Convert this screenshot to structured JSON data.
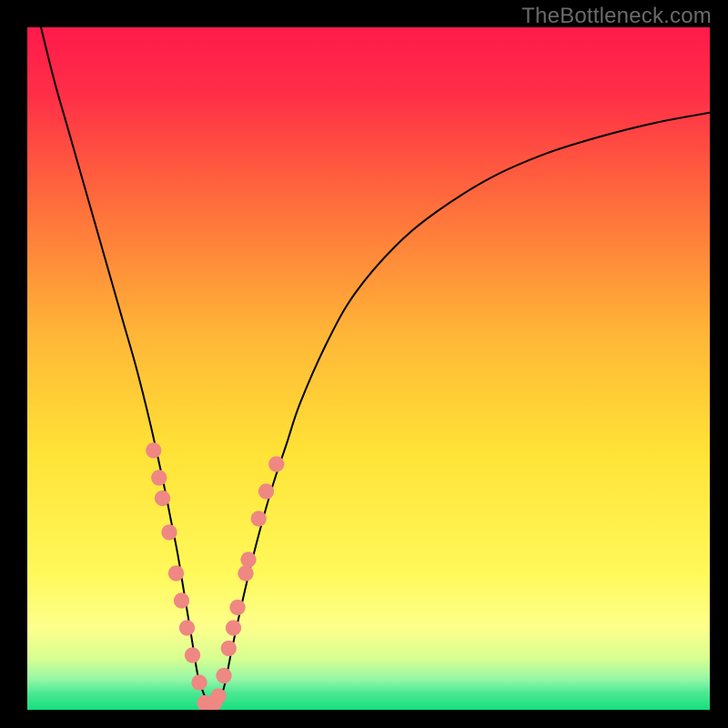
{
  "watermark": "TheBottleneck.com",
  "colors": {
    "frame": "#000000",
    "curve": "#000000",
    "marker_fill": "#ef8783",
    "gradient_stops": [
      {
        "offset": 0.0,
        "color": "#ff1a4b"
      },
      {
        "offset": 0.1,
        "color": "#ff2f47"
      },
      {
        "offset": 0.25,
        "color": "#ff6a3c"
      },
      {
        "offset": 0.45,
        "color": "#ffb637"
      },
      {
        "offset": 0.62,
        "color": "#ffe236"
      },
      {
        "offset": 0.8,
        "color": "#fff95a"
      },
      {
        "offset": 0.88,
        "color": "#fdff8c"
      },
      {
        "offset": 0.925,
        "color": "#d7ff91"
      },
      {
        "offset": 0.955,
        "color": "#96f7a6"
      },
      {
        "offset": 0.975,
        "color": "#4de893"
      },
      {
        "offset": 1.0,
        "color": "#13e07f"
      }
    ]
  },
  "chart_data": {
    "type": "line",
    "title": "",
    "xlabel": "",
    "ylabel": "",
    "xlim": [
      0,
      100
    ],
    "ylim": [
      0,
      100
    ],
    "series": [
      {
        "name": "bottleneck-curve",
        "x": [
          2,
          4,
          6,
          8,
          10,
          12,
          14,
          16,
          18,
          20,
          21,
          22,
          23,
          24,
          25,
          26,
          27,
          28,
          29,
          30,
          32,
          34,
          36,
          38,
          40,
          44,
          48,
          54,
          60,
          68,
          76,
          84,
          92,
          100
        ],
        "y": [
          100,
          92,
          85,
          78,
          71,
          64,
          57,
          50,
          42,
          33,
          28,
          23,
          17,
          11,
          5,
          2,
          0,
          1,
          4,
          9,
          18,
          26,
          33,
          39,
          45,
          54,
          61,
          68,
          73,
          78,
          81.5,
          84,
          86,
          87.5
        ]
      }
    ],
    "markers": {
      "name": "highlight-dots",
      "points": [
        {
          "x": 18.5,
          "y": 38
        },
        {
          "x": 19.3,
          "y": 34
        },
        {
          "x": 19.8,
          "y": 31
        },
        {
          "x": 20.8,
          "y": 26
        },
        {
          "x": 21.8,
          "y": 20
        },
        {
          "x": 22.6,
          "y": 16
        },
        {
          "x": 23.4,
          "y": 12
        },
        {
          "x": 24.2,
          "y": 8
        },
        {
          "x": 25.2,
          "y": 4
        },
        {
          "x": 26.0,
          "y": 1
        },
        {
          "x": 26.7,
          "y": 0
        },
        {
          "x": 27.4,
          "y": 1
        },
        {
          "x": 28.0,
          "y": 2
        },
        {
          "x": 28.8,
          "y": 5
        },
        {
          "x": 29.5,
          "y": 9
        },
        {
          "x": 30.2,
          "y": 12
        },
        {
          "x": 30.8,
          "y": 15
        },
        {
          "x": 32.0,
          "y": 20
        },
        {
          "x": 32.4,
          "y": 22
        },
        {
          "x": 33.9,
          "y": 28
        },
        {
          "x": 35.0,
          "y": 32
        },
        {
          "x": 36.5,
          "y": 36
        }
      ]
    }
  }
}
